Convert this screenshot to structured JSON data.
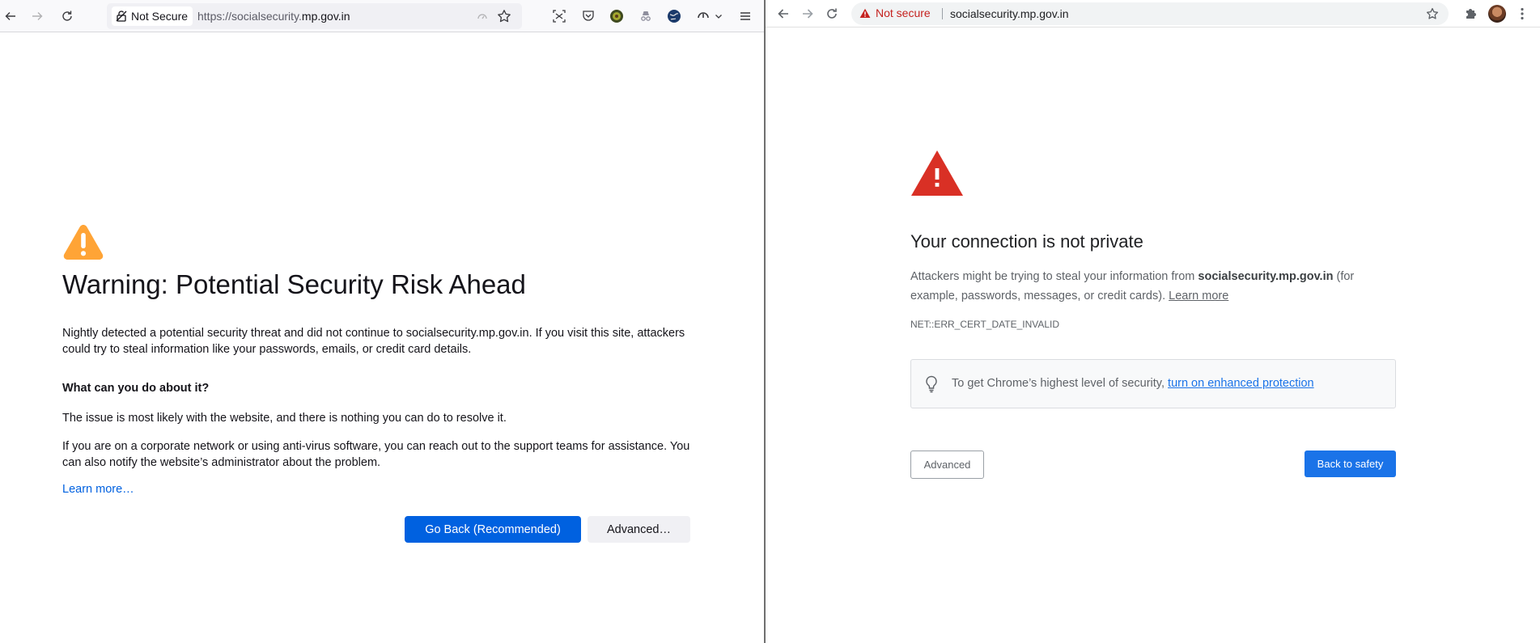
{
  "firefox": {
    "toolbar": {
      "not_secure_label": "Not Secure",
      "url_prefix": "https://socialsecurity.",
      "url_domain": "mp.gov.in"
    },
    "warning": {
      "title": "Warning: Potential Security Risk Ahead",
      "intro": "Nightly detected a potential security threat and did not continue to socialsecurity.mp.gov.in. If you visit this site, attackers could try to steal information like your passwords, emails, or credit card details.",
      "heading": "What can you do about it?",
      "para1": "The issue is most likely with the website, and there is nothing you can do to resolve it.",
      "para2": "If you are on a corporate network or using anti-virus software, you can reach out to the support teams for assistance. You can also notify the website’s administrator about the problem.",
      "learn_more": "Learn more…",
      "go_back_label": "Go Back (Recommended)",
      "advanced_label": "Advanced…"
    },
    "colors": {
      "primary": "#0061e0",
      "warning_icon": "#ffa436"
    }
  },
  "chrome": {
    "toolbar": {
      "not_secure_label": "Not secure",
      "url": "socialsecurity.mp.gov.in"
    },
    "interstitial": {
      "title": "Your connection is not private",
      "desc_before": "Attackers might be trying to steal your information from ",
      "desc_domain": "socialsecurity.mp.gov.in",
      "desc_after": " (for example, passwords, messages, or credit cards). ",
      "learn_more": "Learn more",
      "error_code": "NET::ERR_CERT_DATE_INVALID",
      "tip_before": "To get Chrome’s highest level of security, ",
      "tip_link": "turn on enhanced protection",
      "advanced_label": "Advanced",
      "back_label": "Back to safety"
    },
    "colors": {
      "primary": "#1a73e8",
      "warning_icon": "#d93025",
      "not_secure": "#c5221f"
    }
  }
}
